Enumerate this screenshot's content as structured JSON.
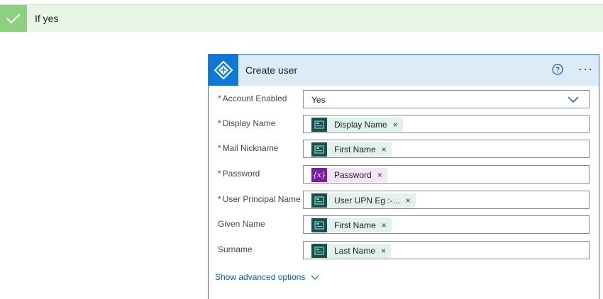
{
  "condition": {
    "label": "If yes"
  },
  "card": {
    "title": "Create user",
    "help_icon": "help-icon",
    "more_icon": "more-options-icon",
    "more_label": "···"
  },
  "fields": [
    {
      "label": "Account Enabled",
      "required": true,
      "type": "dropdown",
      "value": "Yes"
    },
    {
      "label": "Display Name",
      "required": true,
      "type": "token",
      "token": "Display Name",
      "token_kind": "dynamic"
    },
    {
      "label": "Mail Nickname",
      "required": true,
      "type": "token",
      "token": "First Name",
      "token_kind": "dynamic"
    },
    {
      "label": "Password",
      "required": true,
      "type": "token",
      "token": "Password",
      "token_kind": "variable"
    },
    {
      "label": "User Principal Name",
      "required": true,
      "type": "token",
      "token": "User UPN Eg :-...",
      "token_kind": "dynamic"
    },
    {
      "label": "Given Name",
      "required": false,
      "type": "token",
      "token": "First Name",
      "token_kind": "dynamic"
    },
    {
      "label": "Surname",
      "required": false,
      "type": "token",
      "token": "Last Name",
      "token_kind": "dynamic"
    }
  ],
  "required_marker": "*",
  "token_remove": "×",
  "variable_icon_text": "{x}",
  "advanced": {
    "label": "Show advanced options"
  },
  "colors": {
    "accent": "#0f78d4",
    "card_border": "#3a76c4",
    "success": "#8ed081",
    "token_dynamic": "#e1f1ee",
    "token_variable": "#f1e5f7"
  }
}
